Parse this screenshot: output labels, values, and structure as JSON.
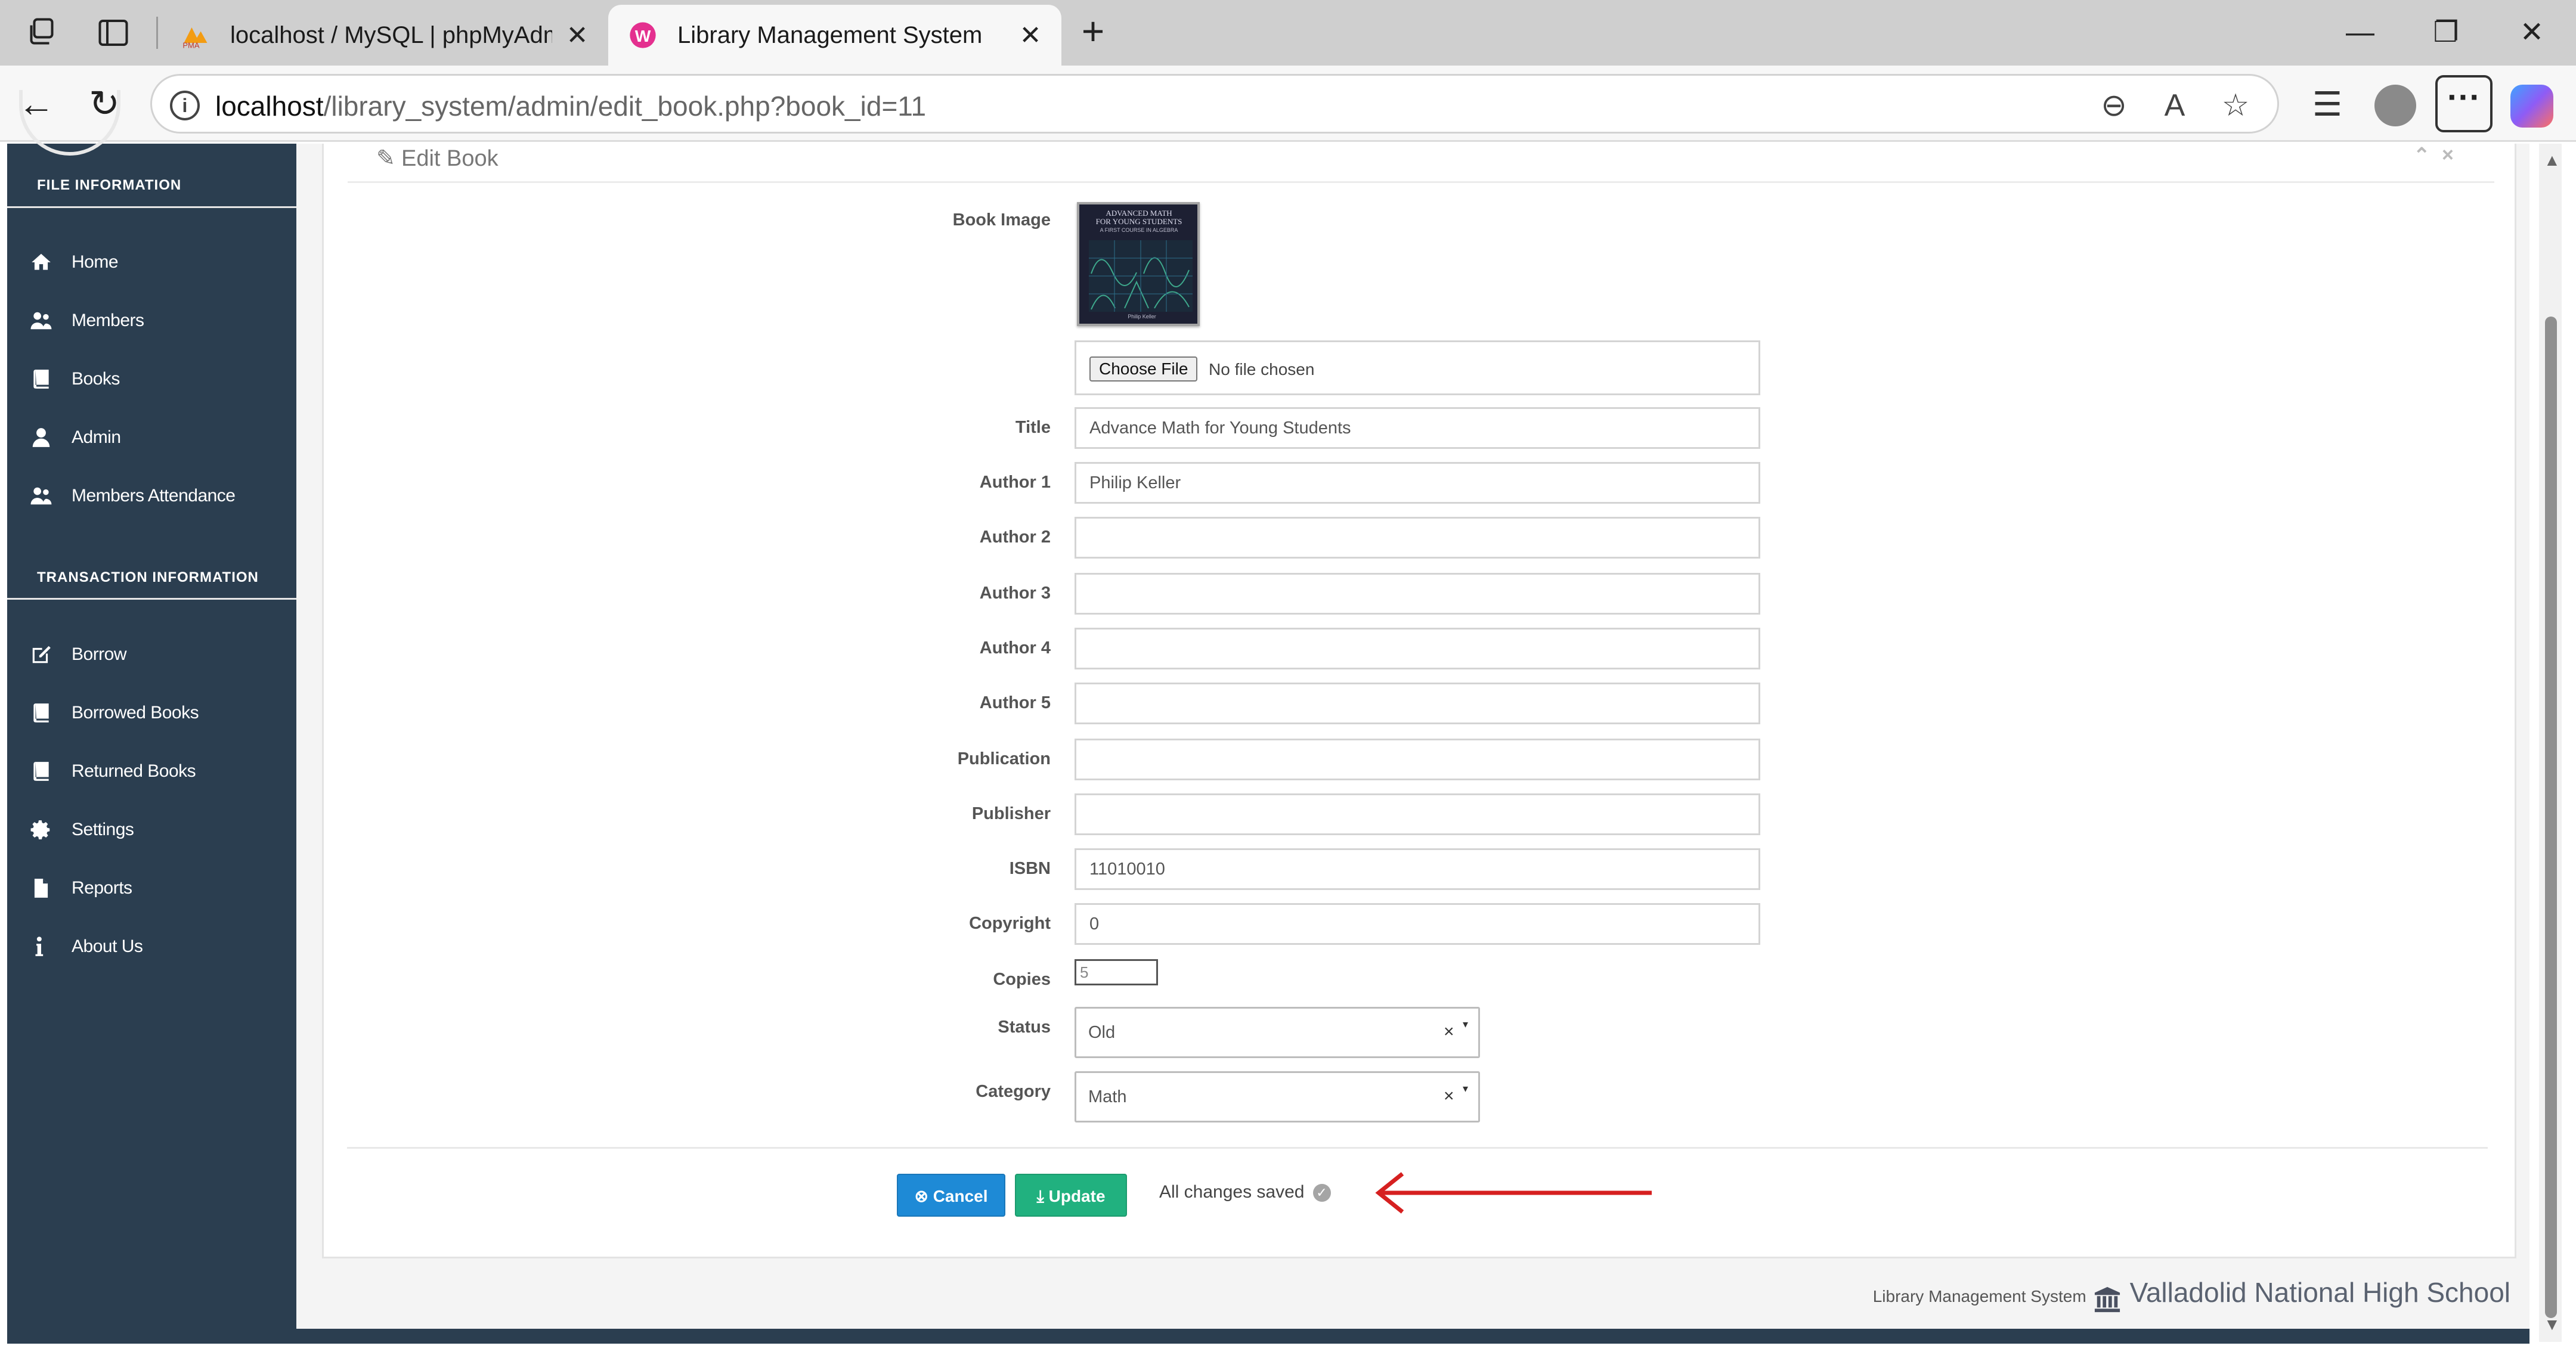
{
  "browser": {
    "tabs": [
      {
        "title": "localhost / MySQL | phpMyAdmin",
        "favicon": "phpmyadmin-icon",
        "active": false
      },
      {
        "title": "Library Management System",
        "favicon": "app-icon",
        "active": true
      }
    ],
    "url_host": "localhost",
    "url_path": "/library_system/admin/edit_book.php?book_id=11"
  },
  "sidebar": {
    "file_heading": "FILE INFORMATION",
    "file_items": [
      {
        "label": "Home",
        "icon": "home-icon"
      },
      {
        "label": "Members",
        "icon": "users-icon"
      },
      {
        "label": "Books",
        "icon": "book-icon"
      },
      {
        "label": "Admin",
        "icon": "user-icon"
      },
      {
        "label": "Members Attendance",
        "icon": "users-icon"
      }
    ],
    "transaction_heading": "TRANSACTION INFORMATION",
    "transaction_items": [
      {
        "label": "Borrow",
        "icon": "edit-icon"
      },
      {
        "label": "Borrowed Books",
        "icon": "book-icon"
      },
      {
        "label": "Returned Books",
        "icon": "book-icon"
      },
      {
        "label": "Settings",
        "icon": "gear-icon"
      },
      {
        "label": "Reports",
        "icon": "file-icon"
      },
      {
        "label": "About Us",
        "icon": "info-icon"
      }
    ]
  },
  "card": {
    "title": "Edit Book"
  },
  "form": {
    "labels": {
      "book_image": "Book Image",
      "title": "Title",
      "author1": "Author 1",
      "author2": "Author 2",
      "author3": "Author 3",
      "author4": "Author 4",
      "author5": "Author 5",
      "publication": "Publication",
      "publisher": "Publisher",
      "isbn": "ISBN",
      "copyright": "Copyright",
      "copies": "Copies",
      "status": "Status",
      "category": "Category"
    },
    "values": {
      "title": "Advance Math for Young Students",
      "author1": "Philip Keller",
      "author2": "",
      "author3": "",
      "author4": "",
      "author5": "",
      "publication": "",
      "publisher": "",
      "isbn": "11010010",
      "copyright": "0",
      "copies": "5",
      "status": "Old",
      "category": "Math"
    },
    "file": {
      "button": "Choose File",
      "status": "No file chosen"
    },
    "cover": {
      "title_line": "ADVANCED MATH",
      "subtitle_line": "FOR YOUNG STUDENTS",
      "tagline": "A FIRST COURSE IN ALGEBRA",
      "author": "Philip Keller"
    },
    "select_clear": "×"
  },
  "actions": {
    "cancel": "Cancel",
    "update": "Update",
    "saved_text": "All changes saved"
  },
  "footer": {
    "small": "Library Management System",
    "school": "Valladolid National High School"
  },
  "colors": {
    "sidebar_bg": "#2b3e50",
    "cancel_btn": "#1e8ad6",
    "update_btn": "#21b17f",
    "annotation_arrow": "#d62020"
  }
}
